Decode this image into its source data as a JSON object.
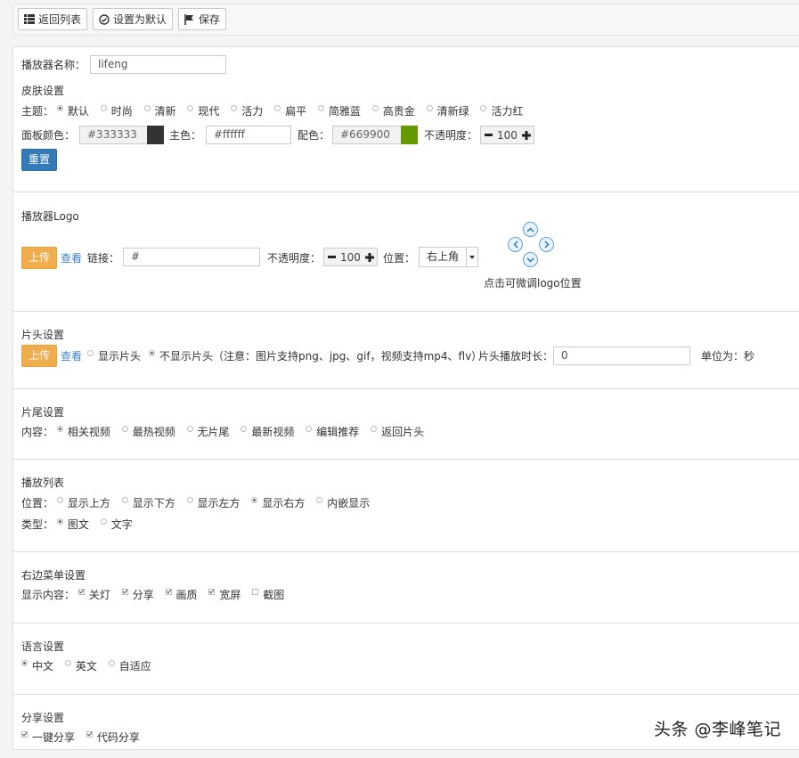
{
  "toolbar": {
    "back_label": "返回列表",
    "default_label": "设置为默认",
    "save_label": "保存"
  },
  "player_name": {
    "label": "播放器名称：",
    "value": "lifeng"
  },
  "skin": {
    "title": "皮肤设置",
    "theme_label": "主题：",
    "themes": [
      {
        "label": "默认",
        "selected": true
      },
      {
        "label": "时尚",
        "selected": false
      },
      {
        "label": "清新",
        "selected": false
      },
      {
        "label": "现代",
        "selected": false
      },
      {
        "label": "活力",
        "selected": false
      },
      {
        "label": "扁平",
        "selected": false
      },
      {
        "label": "简雅蓝",
        "selected": false
      },
      {
        "label": "高贵金",
        "selected": false
      },
      {
        "label": "清新绿",
        "selected": false
      },
      {
        "label": "活力红",
        "selected": false
      }
    ],
    "panel_color_label": "面板颜色：",
    "panel_color_value": "#333333",
    "panel_color_swatch": "#333333",
    "main_color_label": "主色：",
    "main_color_value": "#ffffff",
    "accent_color_label": "配色：",
    "accent_color_value": "#669900",
    "accent_color_swatch": "#669900",
    "opacity_label": "不透明度：",
    "opacity_value": "100",
    "reset_label": "重置"
  },
  "logo": {
    "title": "播放器Logo",
    "upload_label": "上传",
    "view_label": "查看",
    "link_label": "链接：",
    "link_value": "#",
    "opacity_label": "不透明度：",
    "opacity_value": "100",
    "position_label": "位置：",
    "position_value": "右上角",
    "adjust_hint": "点击可微调logo位置"
  },
  "intro": {
    "title": "片头设置",
    "upload_label": "上传",
    "view_label": "查看",
    "show_label": "显示片头",
    "hide_label": "不显示片头（注意：图片支持png、jpg、gif，视频支持mp4、flv）",
    "duration_label": "片头播放时长：",
    "duration_value": "0",
    "unit_label": "单位为：秒"
  },
  "outro": {
    "title": "片尾设置",
    "content_label": "内容：",
    "options": [
      {
        "label": "相关视频",
        "selected": true
      },
      {
        "label": "最热视频",
        "selected": false
      },
      {
        "label": "无片尾",
        "selected": false
      },
      {
        "label": "最新视频",
        "selected": false
      },
      {
        "label": "编辑推荐",
        "selected": false
      },
      {
        "label": "返回片头",
        "selected": false
      }
    ]
  },
  "playlist": {
    "title": "播放列表",
    "position_label": "位置：",
    "positions": [
      {
        "label": "显示上方",
        "selected": false
      },
      {
        "label": "显示下方",
        "selected": false
      },
      {
        "label": "显示左方",
        "selected": false
      },
      {
        "label": "显示右方",
        "selected": true
      },
      {
        "label": "内嵌显示",
        "selected": false
      }
    ],
    "type_label": "类型：",
    "types": [
      {
        "label": "图文",
        "selected": true
      },
      {
        "label": "文字",
        "selected": false
      }
    ]
  },
  "right_menu": {
    "title": "右边菜单设置",
    "content_label": "显示内容：",
    "items": [
      {
        "label": "关灯",
        "checked": true
      },
      {
        "label": "分享",
        "checked": true
      },
      {
        "label": "画质",
        "checked": true
      },
      {
        "label": "宽屏",
        "checked": true
      },
      {
        "label": "截图",
        "checked": false
      }
    ]
  },
  "language": {
    "title": "语言设置",
    "options": [
      {
        "label": "中文",
        "selected": true
      },
      {
        "label": "英文",
        "selected": false
      },
      {
        "label": "自适应",
        "selected": false
      }
    ]
  },
  "share": {
    "title": "分享设置",
    "items": [
      {
        "label": "一键分享",
        "checked": true
      },
      {
        "label": "代码分享",
        "checked": true
      }
    ]
  },
  "watermark_text": "头条 @李峰笔记"
}
